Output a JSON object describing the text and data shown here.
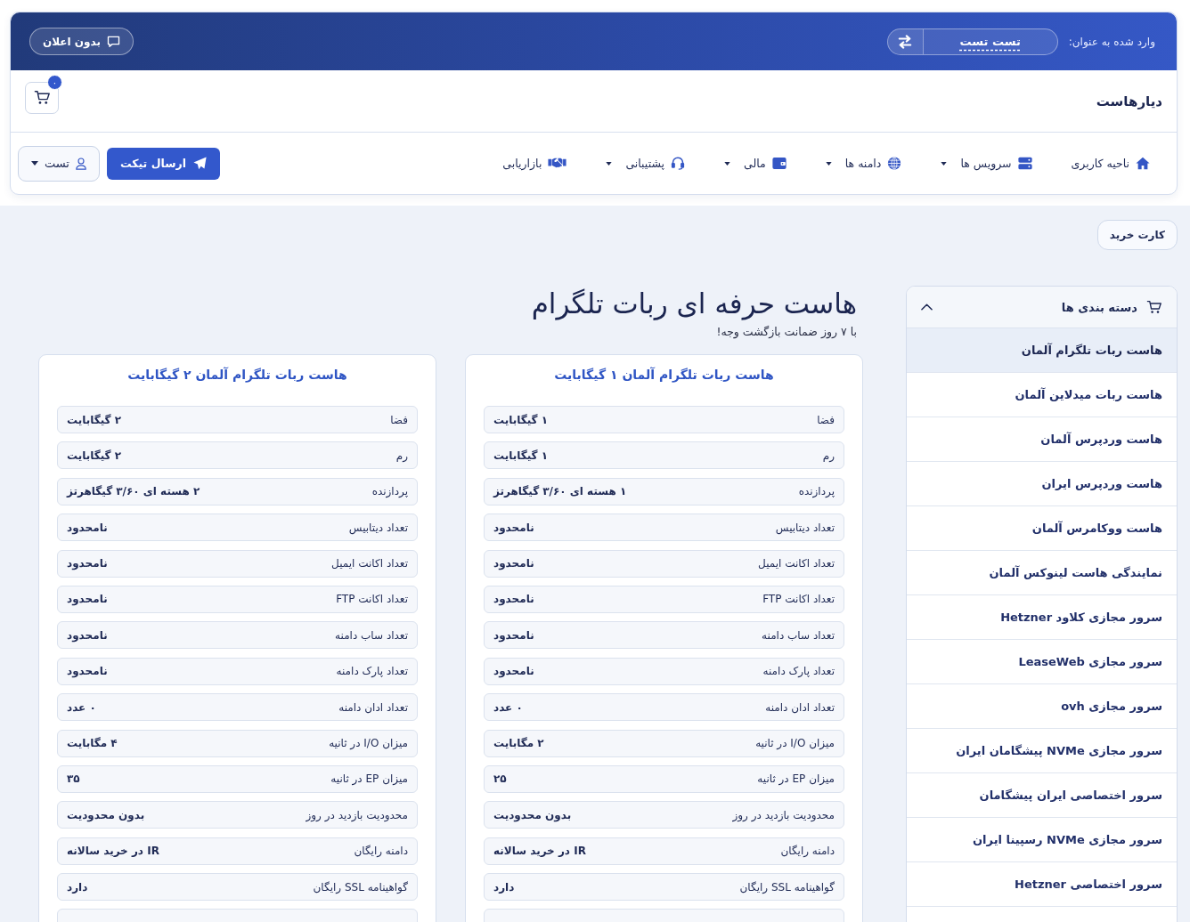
{
  "top_bar": {
    "logged_in_label": "وارد شده به عنوان:",
    "account_name": "تست تست",
    "notifications_button": "بدون اعلان"
  },
  "brand_row": {
    "brand": "دیارهاست",
    "cart_badge": "۰"
  },
  "nav": {
    "items": [
      {
        "kind": "home",
        "label": "ناحیه کاربری",
        "has_dropdown": false
      },
      {
        "kind": "servers",
        "label": "سرویس ها",
        "has_dropdown": true
      },
      {
        "kind": "globe",
        "label": "دامنه ها",
        "has_dropdown": true
      },
      {
        "kind": "wallet",
        "label": "مالی",
        "has_dropdown": true
      },
      {
        "kind": "headset",
        "label": "پشتیبانی",
        "has_dropdown": true
      },
      {
        "kind": "handshake",
        "label": "بازاریابی",
        "has_dropdown": false
      }
    ],
    "ticket_button": "ارسال تیکت",
    "user_menu": "تست"
  },
  "cart_link": "کارت خرید",
  "sidebar": {
    "title": "دسته بندی ها",
    "expanded": true,
    "items": [
      {
        "label": "هاست ربات تلگرام آلمان",
        "selected": true
      },
      {
        "label": "هاست ربات میدلاین آلمان",
        "selected": false
      },
      {
        "label": "هاست وردپرس آلمان",
        "selected": false
      },
      {
        "label": "هاست وردپرس ایران",
        "selected": false
      },
      {
        "label": "هاست ووکامرس آلمان",
        "selected": false
      },
      {
        "label": "نمایندگی هاست لینوکس آلمان",
        "selected": false
      },
      {
        "label": "سرور مجازی کلاود Hetzner",
        "selected": false
      },
      {
        "label": "سرور مجازی LeaseWeb",
        "selected": false
      },
      {
        "label": "سرور مجازی ovh",
        "selected": false
      },
      {
        "label": "سرور مجازی NVMe پیشگامان ایران",
        "selected": false
      },
      {
        "label": "سرور اختصاصی ایران پیشگامان",
        "selected": false
      },
      {
        "label": "سرور مجازی NVMe رسپینا ایران",
        "selected": false
      },
      {
        "label": "سرور اختصاصی Hetzner",
        "selected": false
      }
    ]
  },
  "main": {
    "title": "هاست حرفه ای ربات تلگرام",
    "subtitle": "با ۷ روز ضمانت بازگشت وجه!",
    "products": [
      {
        "name": "هاست ربات تلگرام آلمان ۱ گیگابایت",
        "more_below": true,
        "specs": [
          {
            "label": "فضا",
            "value": "۱ گیگابایت"
          },
          {
            "label": "رم",
            "value": "۱ گیگابایت"
          },
          {
            "label": "پردازنده",
            "value": "۱ هسته ای ۳/۶۰ گیگاهرتز"
          },
          {
            "label": "تعداد دیتابیس",
            "value": "نامحدود"
          },
          {
            "label": "تعداد اکانت ایمیل",
            "value": "نامحدود"
          },
          {
            "label": "تعداد اکانت FTP",
            "value": "نامحدود"
          },
          {
            "label": "تعداد ساب دامنه",
            "value": "نامحدود"
          },
          {
            "label": "تعداد پارک دامنه",
            "value": "نامحدود"
          },
          {
            "label": "تعداد ادان دامنه",
            "value": "۰ عدد"
          },
          {
            "label": "میزان I/O در ثانیه",
            "value": "۲ مگابایت"
          },
          {
            "label": "میزان EP در ثانیه",
            "value": "۲۵"
          },
          {
            "label": "محدودیت بازدید در روز",
            "value": "بدون محدودیت"
          },
          {
            "label": "دامنه رایگان",
            "value": "IR در خرید سالانه"
          },
          {
            "label": "گواهینامه SSL رایگان",
            "value": "دارد"
          }
        ]
      },
      {
        "name": "هاست ربات تلگرام آلمان ۲ گیگابایت",
        "more_below": true,
        "specs": [
          {
            "label": "فضا",
            "value": "۲ گیگابایت"
          },
          {
            "label": "رم",
            "value": "۲ گیگابایت"
          },
          {
            "label": "پردازنده",
            "value": "۲ هسته ای ۳/۶۰ گیگاهرتز"
          },
          {
            "label": "تعداد دیتابیس",
            "value": "نامحدود"
          },
          {
            "label": "تعداد اکانت ایمیل",
            "value": "نامحدود"
          },
          {
            "label": "تعداد اکانت FTP",
            "value": "نامحدود"
          },
          {
            "label": "تعداد ساب دامنه",
            "value": "نامحدود"
          },
          {
            "label": "تعداد پارک دامنه",
            "value": "نامحدود"
          },
          {
            "label": "تعداد ادان دامنه",
            "value": "۰ عدد"
          },
          {
            "label": "میزان I/O در ثانیه",
            "value": "۴ مگابایت"
          },
          {
            "label": "میزان EP در ثانیه",
            "value": "۳۵"
          },
          {
            "label": "محدودیت بازدید در روز",
            "value": "بدون محدودیت"
          },
          {
            "label": "دامنه رایگان",
            "value": "IR در خرید سالانه"
          },
          {
            "label": "گواهینامه SSL رایگان",
            "value": "دارد"
          }
        ]
      }
    ]
  }
}
